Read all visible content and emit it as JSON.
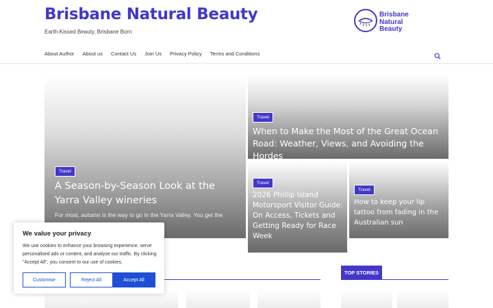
{
  "header": {
    "site_title": "Brisbane Natural Beauty",
    "tagline": "Earth-Kissed Beauty, Brisbane Born",
    "logo_lines": [
      "Brisbane",
      "Natural",
      "Beauty"
    ]
  },
  "nav": {
    "items": [
      {
        "label": "About Author"
      },
      {
        "label": "About us"
      },
      {
        "label": "Contact Us"
      },
      {
        "label": "Join Us"
      },
      {
        "label": "Privacy Policy"
      },
      {
        "label": "Terms and Conditions"
      }
    ]
  },
  "featured": [
    {
      "category": "Travel",
      "title": "A Season-by-Season Look at the Yarra Valley wineries",
      "excerpt": "For most, autumn is the way to go in the Yarra Valley. You get the"
    },
    {
      "category": "Travel",
      "title": "When to Make the Most of the Great Ocean Road: Weather, Views, and Avoiding the Hordes"
    },
    {
      "category": "Travel",
      "title": "2026 Phillip Island Motorsport Visitor Guide: On Access, Tickets and Getting Ready for Race Week"
    },
    {
      "category": "Travel",
      "title": "How to keep your lip tattoo from fading in the Australian sun"
    }
  ],
  "sections": {
    "top_stories_label": "TOP STORIES"
  },
  "cookie": {
    "title": "We value your privacy",
    "text": "We use cookies to enhance your browsing experience, serve personalised ads or content, and analyse our traffic. By clicking \"Accept All\", you consent to our use of cookies.",
    "customise_label": "Customise",
    "reject_label": "Reject All",
    "accept_label": "Accept All"
  },
  "colors": {
    "brand": "#4338ca",
    "cookie_button": "#1e4fd6"
  }
}
